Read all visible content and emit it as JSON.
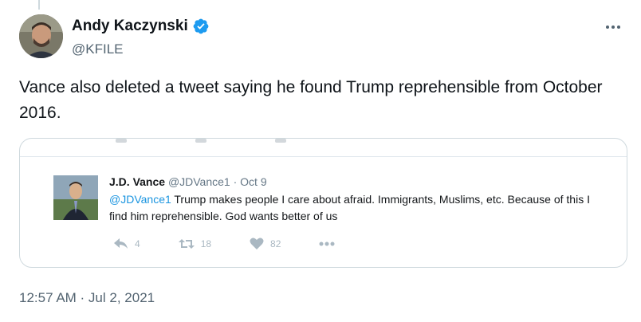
{
  "author": {
    "display_name": "Andy Kaczynski",
    "handle": "@KFILE",
    "verified": true,
    "avatar_icon": "profile-photo"
  },
  "tweet": {
    "text": "Vance also deleted a tweet saying he found Trump reprehensible from October 2016.",
    "timestamp": "12:57 AM · Jul 2, 2021"
  },
  "embedded_tweet": {
    "display_name": "J.D. Vance",
    "handle": "@JDVance1",
    "separator": "·",
    "date": "Oct 9",
    "mention": "@JDVance1",
    "text": " Trump makes people I care about afraid. Immigrants, Muslims, etc. Because of this I find him reprehensible. God wants better of us",
    "actions": {
      "reply_count": "4",
      "retweet_count": "18",
      "like_count": "82"
    }
  },
  "colors": {
    "link": "#1b95e0",
    "verified": "#1d9bf0",
    "secondary_text": "#536471"
  }
}
